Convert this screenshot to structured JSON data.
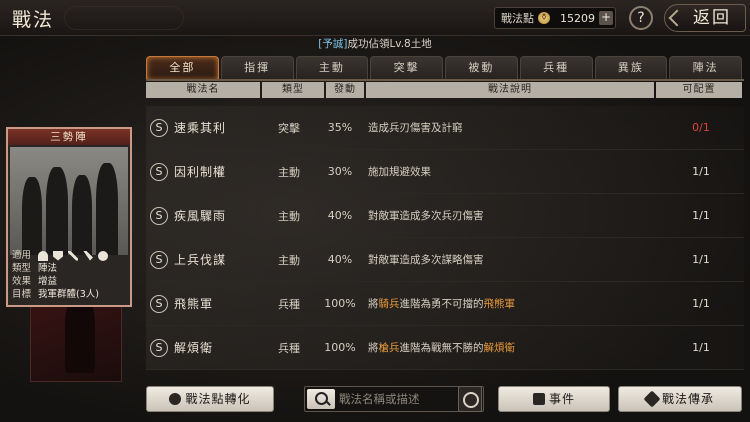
{
  "header": {
    "title": "戰法",
    "points_label": "戰法點",
    "points_value": "15209",
    "help_label": "?",
    "back_label": "返回"
  },
  "subtitle": {
    "tag": "[予誠]",
    "text": "成功佔領Lv.8土地"
  },
  "tabs": [
    {
      "label": "全部",
      "active": true
    },
    {
      "label": "指揮"
    },
    {
      "label": "主動"
    },
    {
      "label": "突擊"
    },
    {
      "label": "被動"
    },
    {
      "label": "兵種"
    },
    {
      "label": "異族"
    },
    {
      "label": "陣法"
    }
  ],
  "columns": {
    "name": "戰法名",
    "type": "類型",
    "rate": "發動",
    "desc": "戰法說明",
    "slots": "可配置"
  },
  "rows": [
    {
      "grade": "S",
      "name": "速乘其利",
      "type": "突擊",
      "rate": "35%",
      "desc": "造成兵刃傷害及計窮",
      "slots": "0/1"
    },
    {
      "grade": "S",
      "name": "因利制權",
      "type": "主動",
      "rate": "30%",
      "desc": "施加規避效果",
      "slots": "1/1"
    },
    {
      "grade": "S",
      "name": "疾風驟雨",
      "type": "主動",
      "rate": "40%",
      "desc": "對敵軍造成多次兵刃傷害",
      "slots": "1/1"
    },
    {
      "grade": "S",
      "name": "上兵伐謀",
      "type": "主動",
      "rate": "40%",
      "desc": "對敵軍造成多次謀略傷害",
      "slots": "1/1"
    },
    {
      "grade": "S",
      "name": "飛熊軍",
      "type": "兵種",
      "rate": "100%",
      "desc_a": "將",
      "desc_b": "騎兵",
      "desc_c": "進階為勇不可擋的",
      "desc_d": "飛熊軍",
      "slots": "1/1"
    },
    {
      "grade": "S",
      "name": "解煩衛",
      "type": "兵種",
      "rate": "100%",
      "desc_a": "將",
      "desc_b": "槍兵",
      "desc_c": "進階為戰無不勝的",
      "desc_d": "解煩衛",
      "slots": "1/1"
    }
  ],
  "card": {
    "title": "三勢陣",
    "info": [
      {
        "key": "適用",
        "value": ""
      },
      {
        "key": "類型",
        "value": "陣法"
      },
      {
        "key": "效果",
        "value": "增益"
      },
      {
        "key": "目標",
        "value": "我軍群體(3人)"
      }
    ]
  },
  "bottom": {
    "convert_label": "戰法點轉化",
    "search_placeholder": "戰法名稱或描述",
    "events_label": "事件",
    "inherit_label": "戰法傳承"
  }
}
